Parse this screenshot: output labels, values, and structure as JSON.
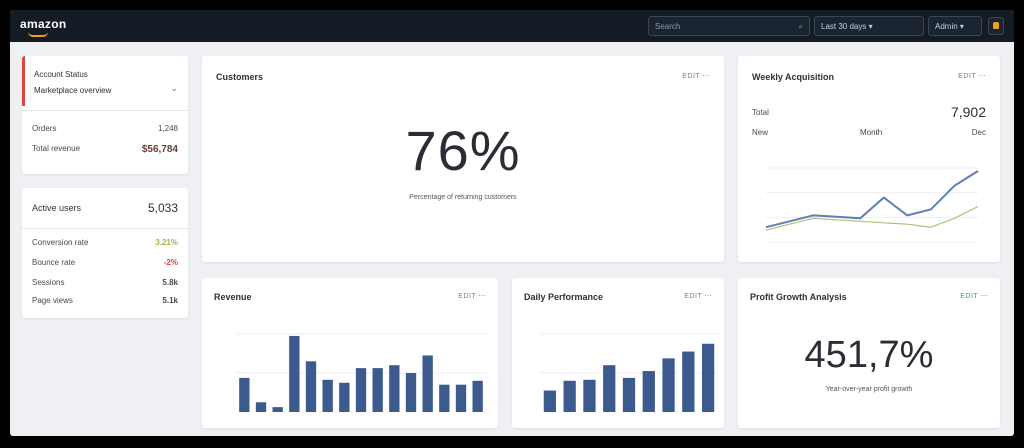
{
  "topbar": {
    "logo": "amazon",
    "search_placeholder": "Search",
    "search_icon": "⌕",
    "range_label": "Last 30 days ▾",
    "account_label": "Admin ▾",
    "notification_icon": "bell-icon"
  },
  "summary_card": {
    "title": "Account Status",
    "subtitle": "Marketplace overview",
    "rows": [
      {
        "label": "Orders",
        "value": "1,248"
      },
      {
        "label": "Total revenue",
        "value": "$56,784"
      }
    ]
  },
  "metrics_card": {
    "title": "Active users",
    "title_value": "5,033",
    "rows": [
      {
        "label": "Conversion rate",
        "value": "3.21%",
        "color": "#9bb84a"
      },
      {
        "label": "Bounce rate",
        "value": "-2%",
        "color": "#e0443a"
      },
      {
        "label": "Sessions",
        "value": "5.8k",
        "color": "#2b313a"
      },
      {
        "label": "Page views",
        "value": "5.1k",
        "color": "#2b313a"
      }
    ]
  },
  "kpi_top": {
    "title": "Customers",
    "actions": "EDIT ⋯",
    "value": "76%",
    "caption": "Percentage of returning customers"
  },
  "line_card": {
    "title": "Weekly Acquisition",
    "actions": "EDIT ⋯",
    "rows": [
      {
        "label": "Total",
        "value": "7,902"
      },
      {
        "label": "New",
        "mid": "Month",
        "value": "Dec"
      }
    ]
  },
  "bar1": {
    "title": "Revenue",
    "actions": "EDIT ⋯"
  },
  "bar2": {
    "title": "Daily Performance",
    "actions": "EDIT ⋯"
  },
  "kpi_bottom": {
    "title": "Profit Growth Analysis",
    "actions": "EDIT ⋯",
    "value": "451,7%",
    "caption": "Year-over-year profit growth"
  },
  "colors": {
    "accent": "#e0443a",
    "bar": "#3d5a8f",
    "line": "#5f7fb5",
    "line2": "#a9c27a"
  },
  "chart_data": [
    {
      "type": "line",
      "x": [
        1,
        2,
        3,
        4,
        5,
        6,
        7,
        8,
        9,
        10
      ],
      "series": [
        {
          "values": [
            10,
            14,
            18,
            17,
            16,
            30,
            18,
            22,
            38,
            48
          ]
        },
        {
          "values": [
            8,
            12,
            16,
            15,
            14,
            13,
            12,
            10,
            16,
            24
          ]
        }
      ],
      "ylim": [
        0,
        50
      ]
    },
    {
      "type": "bar",
      "values": [
        35,
        10,
        5,
        78,
        52,
        33,
        30,
        45,
        45,
        48,
        40,
        58,
        28,
        28,
        32
      ],
      "ylim": [
        0,
        80
      ]
    },
    {
      "type": "bar",
      "values": [
        22,
        32,
        33,
        48,
        35,
        42,
        55,
        62,
        70
      ],
      "ylim": [
        0,
        80
      ]
    }
  ]
}
